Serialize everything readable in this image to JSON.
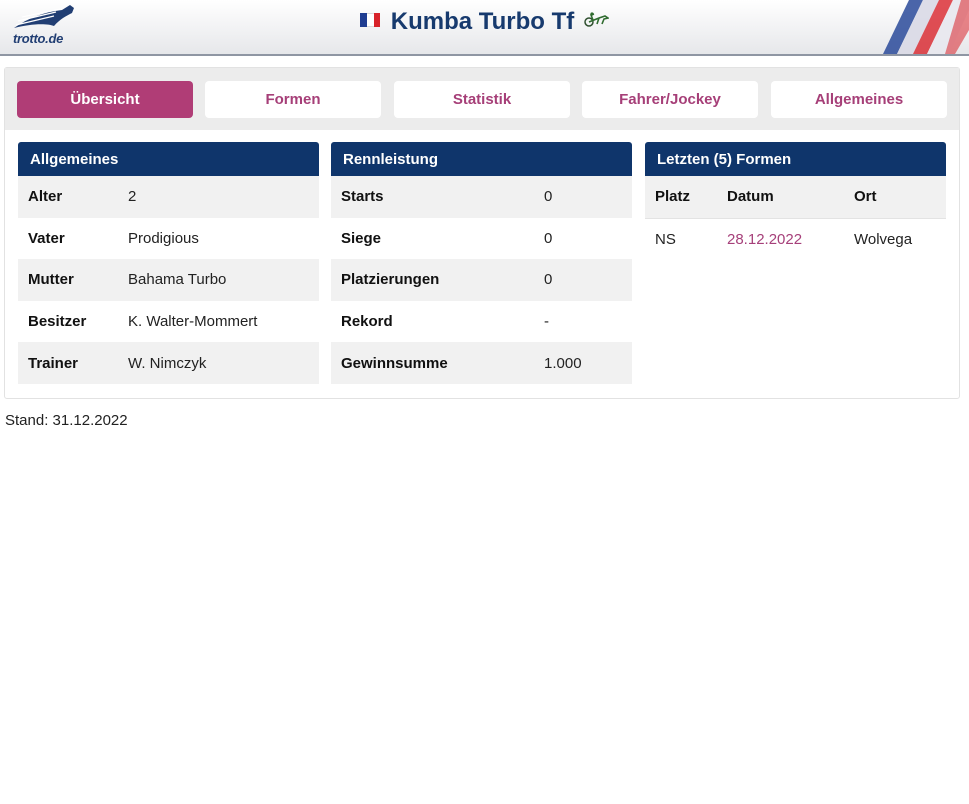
{
  "header": {
    "logo_text": "trotto.de",
    "title": "Kumba Turbo Tf",
    "flag_colors": [
      "#1f3d91",
      "#ffffff",
      "#d8232a"
    ]
  },
  "tabs": [
    {
      "label": "Übersicht",
      "active": true
    },
    {
      "label": "Formen",
      "active": false
    },
    {
      "label": "Statistik",
      "active": false
    },
    {
      "label": "Fahrer/Jockey",
      "active": false
    },
    {
      "label": "Allgemeines",
      "active": false
    }
  ],
  "allgemeines": {
    "title": "Allgemeines",
    "rows": [
      {
        "label": "Alter",
        "value": "2"
      },
      {
        "label": "Vater",
        "value": "Prodigious"
      },
      {
        "label": "Mutter",
        "value": "Bahama Turbo"
      },
      {
        "label": "Besitzer",
        "value": "K. Walter-Mommert"
      },
      {
        "label": "Trainer",
        "value": "W. Nimczyk"
      }
    ]
  },
  "rennleistung": {
    "title": "Rennleistung",
    "rows": [
      {
        "label": "Starts",
        "value": "0"
      },
      {
        "label": "Siege",
        "value": "0"
      },
      {
        "label": "Platzierungen",
        "value": "0"
      },
      {
        "label": "Rekord",
        "value": "-"
      },
      {
        "label": "Gewinnsumme",
        "value": "1.000"
      }
    ]
  },
  "formen": {
    "title": "Letzten (5) Formen",
    "columns": [
      "Platz",
      "Datum",
      "Ort"
    ],
    "rows": [
      {
        "platz": "NS",
        "datum": "28.12.2022",
        "ort": "Wolvega"
      }
    ]
  },
  "stand": "Stand: 31.12.2022",
  "colors": {
    "accent": "#b03d76",
    "link": "#a6407a",
    "navy": "#0f356b"
  }
}
